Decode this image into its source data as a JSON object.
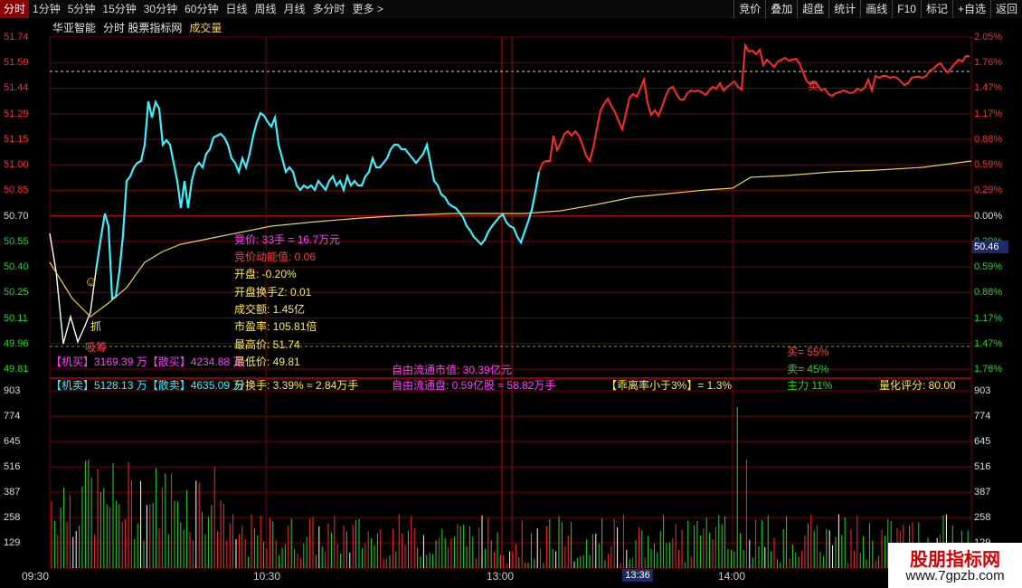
{
  "toolbar": {
    "timeframes": [
      "分时",
      "1分钟",
      "5分钟",
      "15分钟",
      "30分钟",
      "60分钟",
      "日线",
      "周线",
      "月线",
      "多分时",
      "更多 >"
    ],
    "active": "分时",
    "right_buttons": [
      "竞价",
      "叠加",
      "超盘",
      "统计",
      "画线",
      "F10",
      "标记",
      "+自选",
      "返回"
    ]
  },
  "title": {
    "name": "华亚智能",
    "indicator": "分时 股票指标网",
    "vol": "成交量"
  },
  "y_left": [
    "51.74",
    "51.59",
    "51.44",
    "51.29",
    "51.15",
    "51.00",
    "50.85",
    "50.70",
    "50.55",
    "50.40",
    "50.25",
    "50.11",
    "49.96",
    "49.81"
  ],
  "y_right": [
    "2.05%",
    "1.76%",
    "1.47%",
    "1.17%",
    "0.88%",
    "0.59%",
    "0.29%",
    "0.00%",
    "0.29%",
    "0.59%",
    "0.88%",
    "1.17%",
    "1.47%",
    "1.76%"
  ],
  "vol_left": [
    "903",
    "774",
    "645",
    "516",
    "387",
    "258",
    "129"
  ],
  "vol_right": [
    "903",
    "774",
    "645",
    "516",
    "387",
    "258",
    "129"
  ],
  "x_labels": [
    "09:30",
    "10:30",
    "13:00",
    "14:00"
  ],
  "cursor": {
    "price": "50.46",
    "time": "13:36"
  },
  "markers": {
    "zhua": "抓",
    "xizhu": "吸筹",
    "smile": "☺"
  },
  "info": {
    "auction": "竞价: 33手 = 16.7万元",
    "auction_power": "竞价动能值: 0.06",
    "open": "开盘: -0.20%",
    "turnover": "开盘换手Z: 0.01",
    "amount": "成交额: 1.45亿",
    "pe": "市盈率: 105.81倍",
    "high": "最高价: 51.74",
    "low": "最低价: 49.81",
    "float_mv": "自由流通市值: 30.39亿元",
    "float_shares": "自由流通盘: 0.59亿股 ≈ 58.82万手",
    "deviation": "【乖离率小于3%】= 1.3%",
    "mai_ratio": "买= 55%",
    "sell_ratio": "卖= 45%",
    "sell_label": "卖",
    "score": "量化评分: 80.00",
    "jimai": "【机买】3169.39 万【散买】4234.88 万",
    "jimai2": "【机卖】5128.13 万【散卖】4635.09 万",
    "fen_huan": "分换手: 3.39% ≈ 2.84万手",
    "zhu_percent": "主力 11%"
  },
  "watermark": {
    "line1": "股朋指标网",
    "line2": "www.7gpzb.com"
  },
  "colors": {
    "up": "#ff2a2a",
    "cyan": "#3ef0ff",
    "white": "#ffffff",
    "avg": "#e6d35a",
    "grid": "#7a0000",
    "green": "#1fd81f",
    "magenta": "#ff3dff"
  }
}
